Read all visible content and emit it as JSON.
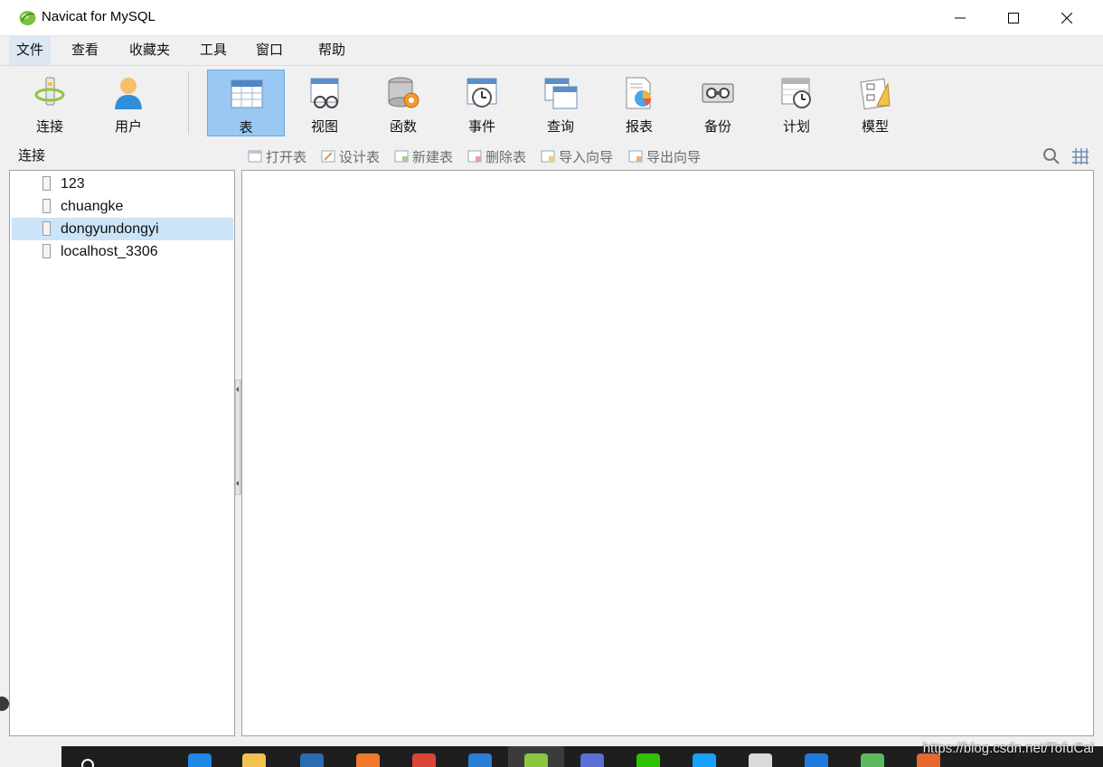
{
  "window": {
    "title": "Navicat for MySQL",
    "controls": {
      "minimize_icon": "minimize-icon",
      "maximize_icon": "maximize-icon",
      "close_icon": "close-icon"
    }
  },
  "menu": {
    "items": [
      {
        "label": "文件"
      },
      {
        "label": "查看"
      },
      {
        "label": "收藏夹"
      },
      {
        "label": "工具"
      },
      {
        "label": "窗口"
      },
      {
        "label": "帮助"
      }
    ]
  },
  "toolbar": {
    "items": [
      {
        "label": "连接",
        "icon": "connection-icon"
      },
      {
        "label": "用户",
        "icon": "user-icon"
      },
      {
        "label": "表",
        "icon": "table-icon",
        "active": true
      },
      {
        "label": "视图",
        "icon": "view-icon"
      },
      {
        "label": "函数",
        "icon": "function-icon"
      },
      {
        "label": "事件",
        "icon": "event-icon"
      },
      {
        "label": "查询",
        "icon": "query-icon"
      },
      {
        "label": "报表",
        "icon": "report-icon"
      },
      {
        "label": "备份",
        "icon": "backup-icon"
      },
      {
        "label": "计划",
        "icon": "schedule-icon"
      },
      {
        "label": "模型",
        "icon": "model-icon"
      }
    ]
  },
  "sidebar": {
    "header": "连接",
    "connections": [
      {
        "name": "123"
      },
      {
        "name": "chuangke"
      },
      {
        "name": "dongyundongyi",
        "selected": true
      },
      {
        "name": "localhost_3306"
      }
    ]
  },
  "object_toolbar": {
    "buttons": [
      {
        "label": "打开表",
        "icon": "open-table-icon"
      },
      {
        "label": "设计表",
        "icon": "design-table-icon"
      },
      {
        "label": "新建表",
        "icon": "new-table-icon"
      },
      {
        "label": "删除表",
        "icon": "delete-table-icon"
      },
      {
        "label": "导入向导",
        "icon": "import-wizard-icon"
      },
      {
        "label": "导出向导",
        "icon": "export-wizard-icon"
      }
    ],
    "search_icon": "search-icon",
    "view_mode_icon": "grid-view-icon"
  },
  "watermark": "https://blog.csdn.net/TofuCai",
  "colors": {
    "selected_row": "#cce4f7",
    "active_tool": "#99c9f2",
    "disabled_text": "#6c6c6c"
  }
}
